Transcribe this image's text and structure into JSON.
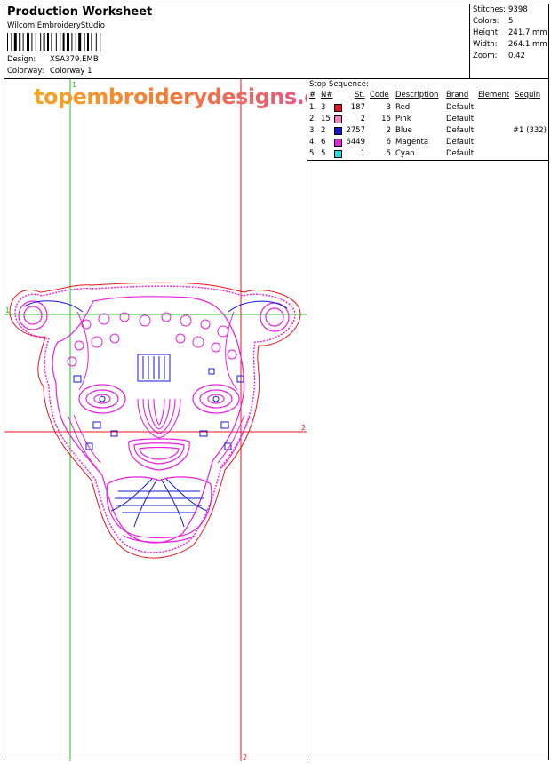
{
  "header": {
    "title": "Production Worksheet",
    "software": "Wilcom EmbroideryStudio",
    "design_label": "Design:",
    "design_value": "XSA379.EMB",
    "colorway_label": "Colorway:",
    "colorway_value": "Colorway 1"
  },
  "stats": {
    "stitches_label": "Stitches:",
    "stitches": "9398",
    "colors_label": "Colors:",
    "colors": "5",
    "height_label": "Height:",
    "height": "241.7 mm",
    "width_label": "Width:",
    "width": "264.1 mm",
    "zoom_label": "Zoom:",
    "zoom": "0.42"
  },
  "watermark": "topembroiderydesigns.com",
  "guides": {
    "h1": "1",
    "v1": "1",
    "h2": "2",
    "v2": "2"
  },
  "stop_sequence": {
    "title": "Stop Sequence:",
    "headers": {
      "hash": "#",
      "nhash": "N#",
      "st": "St.",
      "code": "Code",
      "desc": "Description",
      "brand": "Brand",
      "element": "Element",
      "sequin": "Sequin"
    },
    "rows": [
      {
        "num": "1.",
        "n": "3",
        "color": "#e8141b",
        "st": "187",
        "code": "3",
        "desc": "Red",
        "brand": "Default",
        "sequin": ""
      },
      {
        "num": "2.",
        "n": "15",
        "color": "#f27fbf",
        "st": "2",
        "code": "15",
        "desc": "Pink",
        "brand": "Default",
        "sequin": ""
      },
      {
        "num": "3.",
        "n": "2",
        "color": "#1417d6",
        "st": "2757",
        "code": "2",
        "desc": "Blue",
        "brand": "Default",
        "sequin": "#1 (332)"
      },
      {
        "num": "4.",
        "n": "6",
        "color": "#e81ee0",
        "st": "6449",
        "code": "6",
        "desc": "Magenta",
        "brand": "Default",
        "sequin": ""
      },
      {
        "num": "5.",
        "n": "5",
        "color": "#22e0e8",
        "st": "1",
        "code": "5",
        "desc": "Cyan",
        "brand": "Default",
        "sequin": ""
      }
    ]
  }
}
